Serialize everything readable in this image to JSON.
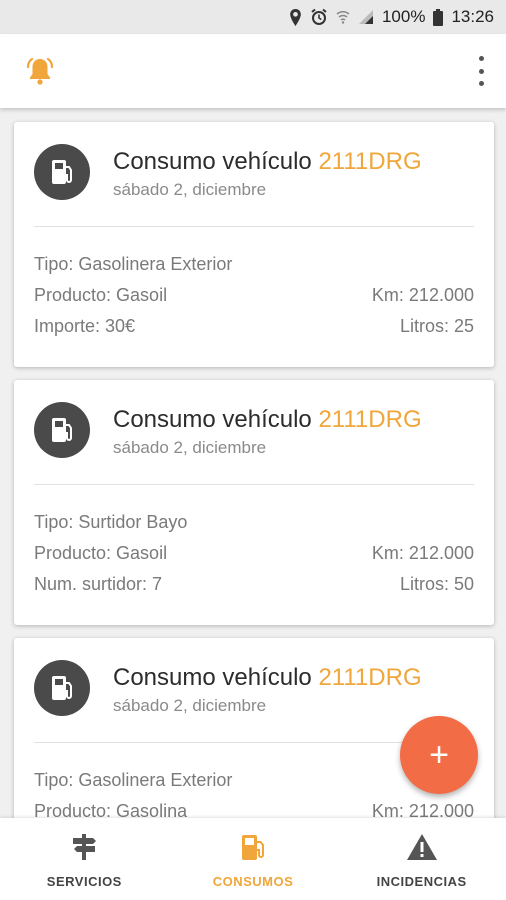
{
  "status_bar": {
    "battery": "100%",
    "time": "13:26"
  },
  "app_bar": {
    "bell_icon": "bell-icon",
    "more_icon": "more-vertical-icon"
  },
  "colors": {
    "accent": "#f0a63a",
    "fab": "#f26c46",
    "avatar": "#4a4a4a"
  },
  "cards": [
    {
      "title_prefix": "Consumo vehículo",
      "plate": "2111DRG",
      "date": "sábado 2, diciembre",
      "tipo": "Tipo: Gasolinera Exterior",
      "producto": "Producto: Gasoil",
      "km": "Km: 212.000",
      "extra": "Importe: 30€",
      "litros": "Litros: 25"
    },
    {
      "title_prefix": "Consumo vehículo",
      "plate": "2111DRG",
      "date": "sábado 2, diciembre",
      "tipo": "Tipo: Surtidor Bayo",
      "producto": "Producto: Gasoil",
      "km": "Km: 212.000",
      "extra": "Num. surtidor: 7",
      "litros": "Litros: 50"
    },
    {
      "title_prefix": "Consumo vehículo",
      "plate": "2111DRG",
      "date": "sábado 2, diciembre",
      "tipo": "Tipo: Gasolinera Exterior",
      "producto": "Producto: Gasolina",
      "km": "Km: 212.000"
    }
  ],
  "fab": {
    "label": "+"
  },
  "bottom_nav": [
    {
      "label": "SERVICIOS",
      "icon": "signpost-icon",
      "active": false
    },
    {
      "label": "CONSUMOS",
      "icon": "fuel-pump-icon",
      "active": true
    },
    {
      "label": "INCIDENCIAS",
      "icon": "warning-icon",
      "active": false
    }
  ]
}
